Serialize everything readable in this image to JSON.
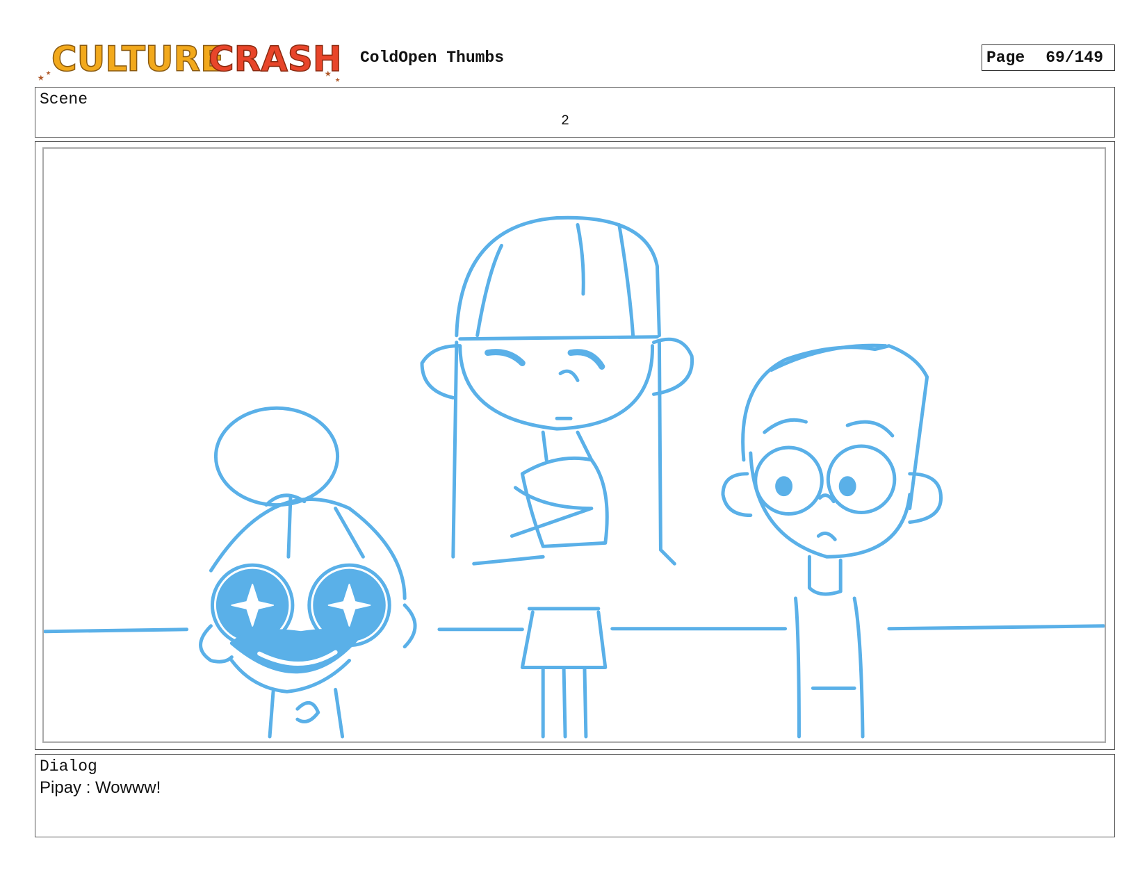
{
  "header": {
    "logo_text": "CULTURE CRASH",
    "doc_title": "ColdOpen Thumbs",
    "page_label": "Page",
    "page_value": "69/149"
  },
  "scene": {
    "label": "Scene",
    "number": "2"
  },
  "panel": {
    "line_color": "#5ab0e8"
  },
  "dialog": {
    "label": "Dialog",
    "text": "Pipay : Wowww!"
  }
}
